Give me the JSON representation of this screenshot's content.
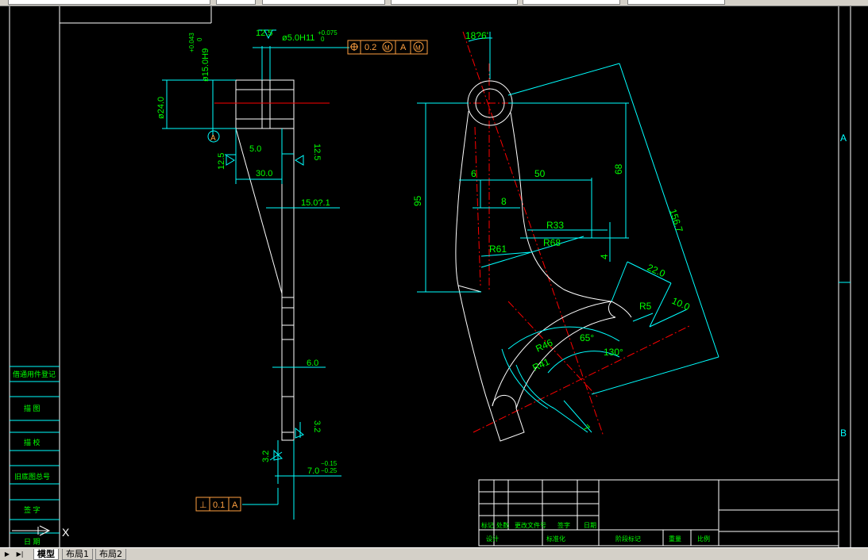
{
  "window": {
    "title_fragment": ""
  },
  "layout_tabs": [
    {
      "label": "模型",
      "active": true
    },
    {
      "label": "布局1",
      "active": false
    },
    {
      "label": "布局2",
      "active": false
    }
  ],
  "colors": {
    "background": "#000000",
    "outline": "#ffffff",
    "dimension": "#00ffff",
    "dim_text": "#00ff00",
    "centerline": "#ff0000",
    "frame": "#ffffff",
    "tolerance_frame": "#ffa040"
  },
  "zones": {
    "a": "A",
    "b": "B"
  },
  "ucs": {
    "x_label": "X"
  },
  "side_view": {
    "roughness_top": "12.5",
    "hole_dim": "ø5.0H11",
    "hole_tol_upper": "+0.075",
    "hole_tol_lower": "0",
    "bore_dim": "ø15.0H9",
    "bore_tol_upper": "+0.043",
    "bore_tol_lower": "0",
    "outer_dim": "ø24.0",
    "datum_a": "A",
    "position_tol": {
      "symbol": "⌖",
      "value": "0.2",
      "mod1": "M",
      "datum": "A",
      "mod2": "M"
    },
    "dim_5": "5.0",
    "rough_left": "12.5",
    "rough_right": "12.5",
    "dim_30": "30.0",
    "dim_15": "15.0?.1",
    "dim_6": "6.0",
    "rough_32_right": "3.2",
    "rough_32_left": "3.2",
    "dim_7": "7.0",
    "dim_7_upper": "−0.15",
    "dim_7_lower": "−0.25",
    "perp_tol": {
      "symbol": "⊥",
      "value": "0.1",
      "datum": "A"
    }
  },
  "front_view": {
    "angle_top": "18?6'",
    "dim_95": "95",
    "dim_6": "6",
    "dim_50": "50",
    "dim_8": "8",
    "dim_68": "68",
    "dim_R33": "R33",
    "dim_R68": "R68",
    "dim_R61": "R61",
    "dim_4": "4",
    "dim_156": "156.7",
    "dim_22": "22.0",
    "dim_10": "10.0",
    "dim_R5": "R5",
    "dim_65": "65°",
    "dim_130": "130°",
    "dim_R46": "R46",
    "dim_R41": "R41",
    "dim_7": "7"
  },
  "left_panel": {
    "labels": [
      "借通用件登记",
      "描 图",
      "描 校",
      "旧底图总号",
      "签 字",
      "日 期"
    ]
  },
  "title_block": {
    "row1": [
      "标记",
      "处数",
      "更改文件号",
      "签字",
      "日期"
    ],
    "row2": [
      "设计",
      "标准化",
      "阶段标记",
      "重量",
      "比例"
    ]
  }
}
